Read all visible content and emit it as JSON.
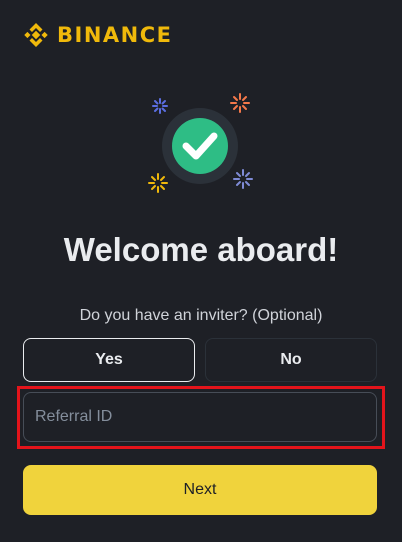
{
  "brand": {
    "name": "BINANCE",
    "logo_icon": "binance-logo-icon",
    "color": "#f0b90b"
  },
  "hero": {
    "icon": "checkmark-success-icon",
    "check_color": "#2ebd85",
    "sparkle_colors": [
      "#5b6ee1",
      "#f5784a",
      "#f0b90b",
      "#7f8bd6"
    ]
  },
  "welcome": {
    "title": "Welcome aboard!",
    "question": "Do you have an inviter? (Optional)"
  },
  "inviter_choice": {
    "yes_label": "Yes",
    "no_label": "No",
    "selected": "Yes"
  },
  "referral": {
    "placeholder": "Referral ID",
    "value": ""
  },
  "actions": {
    "next_label": "Next"
  },
  "colors": {
    "background": "#1e2026",
    "primary_button": "#f0d33c",
    "highlight": "#e3141b"
  }
}
